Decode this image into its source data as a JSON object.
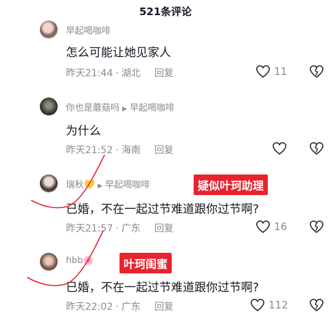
{
  "header": {
    "title": "521条评论"
  },
  "comments": [
    {
      "author": "早起喝咖啡",
      "reply_to": "",
      "text": "怎么可能让她见家人",
      "time": "昨天21:44",
      "location": "湖北",
      "reply_label": "回复",
      "likes": "11"
    },
    {
      "author": "你也是蘑菇吗",
      "reply_to": "早起喝咖啡",
      "text": "为什么",
      "time": "昨天21:52",
      "location": "海南",
      "reply_label": "回复",
      "likes": ""
    },
    {
      "author": "瑞秋💛",
      "reply_to": "早起喝咖啡",
      "text": "已婚，不在一起过节难道跟你过节啊?",
      "time": "昨天21:57",
      "location": "广东",
      "reply_label": "回复",
      "likes": "16"
    },
    {
      "author": "hbb🌸",
      "reply_to": "",
      "text": "已婚，不在一起过节难道跟你过节啊?",
      "time": "昨天22:02",
      "location": "广东",
      "reply_label": "回复",
      "likes": "112"
    }
  ],
  "annotations": {
    "tag1": "疑似叶珂助理",
    "tag2": "叶珂闺蜜"
  },
  "colors": {
    "accent_red": "#e8232f",
    "secondary_text": "#8a8b91",
    "primary_text": "#161823"
  },
  "icons": [
    "heart-icon",
    "broken-heart-icon",
    "reply-arrow-icon"
  ]
}
